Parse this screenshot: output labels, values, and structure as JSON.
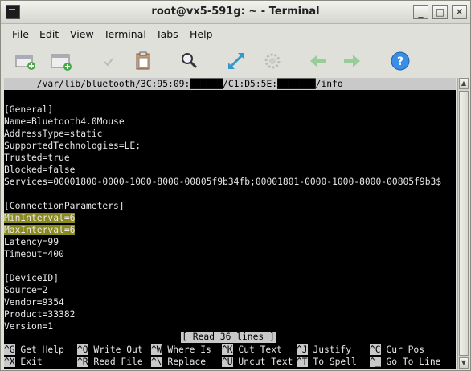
{
  "window": {
    "title": "root@vx5-591g: ~ - Terminal"
  },
  "menu": [
    "File",
    "Edit",
    "View",
    "Terminal",
    "Tabs",
    "Help"
  ],
  "toolbar_icons": [
    "new-tab-icon",
    "new-window-icon",
    "close-tab-icon",
    "paste-icon",
    "find-icon",
    "fullscreen-icon",
    "settings-icon",
    "back-icon",
    "forward-icon",
    "help-icon"
  ],
  "terminal": {
    "title_line": "      /var/lib/bluetooth/3C:95:09:██████/C1:D5:5E:███████/info",
    "lines": [
      "[General]",
      "Name=Bluetooth4.0Mouse",
      "AddressType=static",
      "SupportedTechnologies=LE;",
      "Trusted=true",
      "Blocked=false",
      "Services=00001800-0000-1000-8000-00805f9b34fb;00001801-0000-1000-8000-00805f9b3$",
      "",
      "[ConnectionParameters]",
      "MinInterval=6",
      "MaxInterval=6",
      "Latency=99",
      "Timeout=400",
      "",
      "[DeviceID]",
      "Source=2",
      "Vendor=9354",
      "Product=33382",
      "Version=1"
    ],
    "highlighted_lines": [
      9,
      10
    ],
    "status": "[ Read 36 lines ]",
    "shortcuts_row1": [
      {
        "key": "^G",
        "label": "Get Help"
      },
      {
        "key": "^O",
        "label": "Write Out"
      },
      {
        "key": "^W",
        "label": "Where Is"
      },
      {
        "key": "^K",
        "label": "Cut Text"
      },
      {
        "key": "^J",
        "label": "Justify"
      },
      {
        "key": "^C",
        "label": "Cur Pos"
      }
    ],
    "shortcuts_row2": [
      {
        "key": "^X",
        "label": "Exit"
      },
      {
        "key": "^R",
        "label": "Read File"
      },
      {
        "key": "^\\",
        "label": "Replace"
      },
      {
        "key": "^U",
        "label": "Uncut Text"
      },
      {
        "key": "^T",
        "label": "To Spell"
      },
      {
        "key": "^_",
        "label": "Go To Line"
      }
    ]
  },
  "colors": {
    "terminal_bg": "#000000",
    "highlight": "#8a8a1f",
    "window_bg": "#e0e0da"
  }
}
